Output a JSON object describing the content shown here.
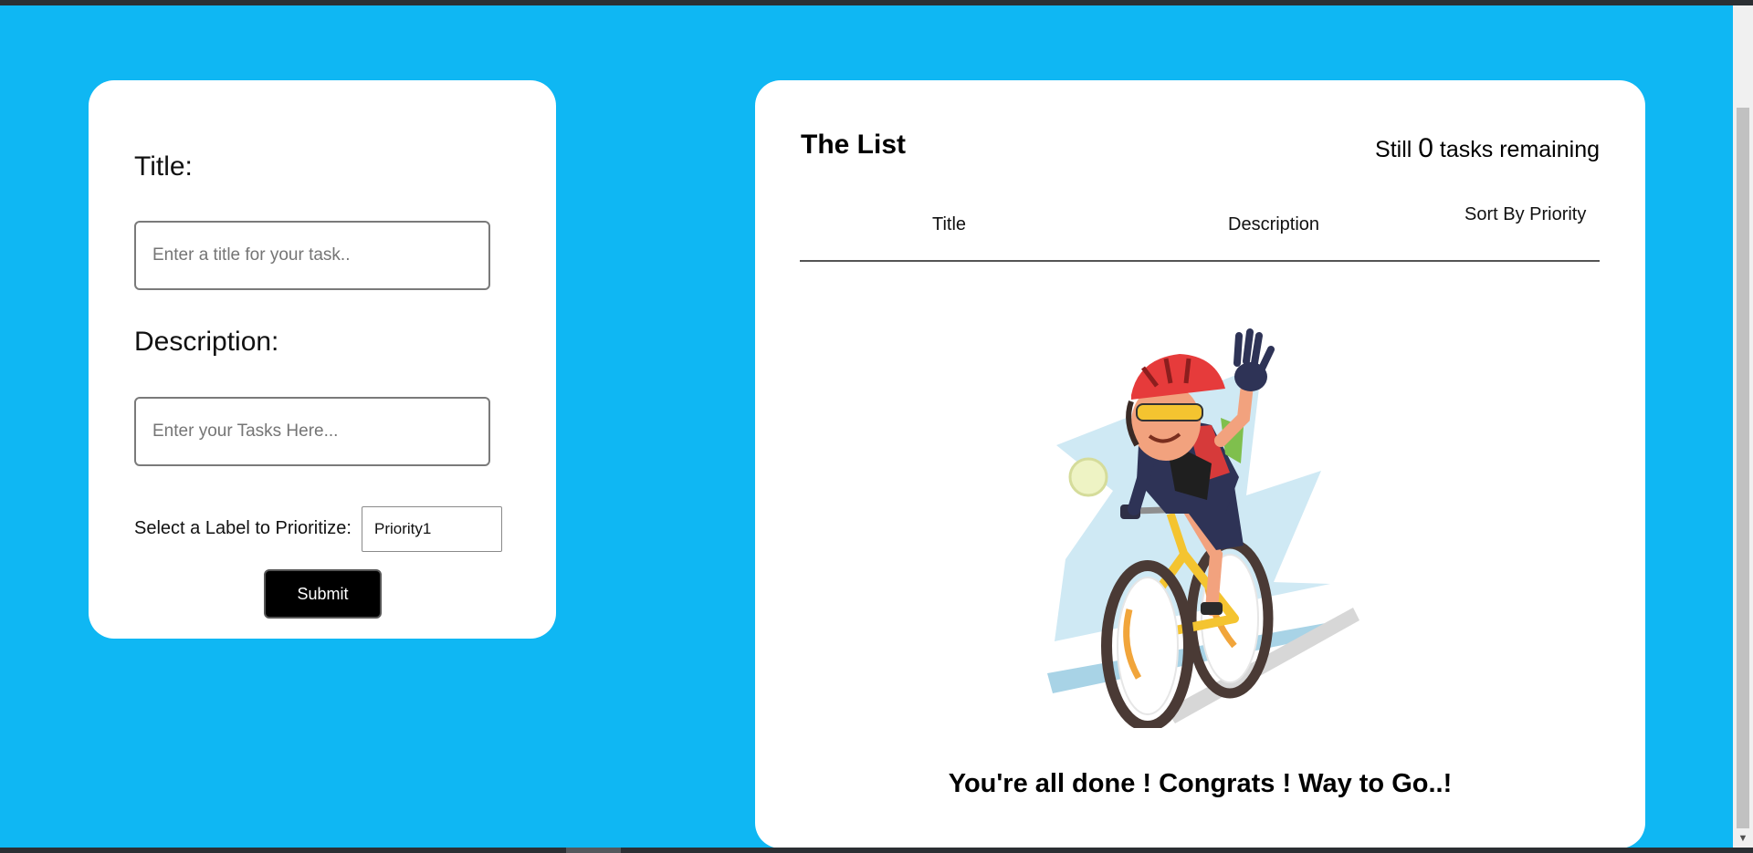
{
  "form": {
    "title_label": "Title:",
    "title_placeholder": "Enter a title for your task..",
    "title_value": "",
    "description_label": "Description:",
    "description_placeholder": "Enter your Tasks Here...",
    "description_value": "",
    "priority_label": "Select a Label to Prioritize:",
    "priority_selected": "Priority1",
    "submit_label": "Submit"
  },
  "list": {
    "heading": "The List",
    "remaining_prefix": "Still",
    "remaining_count": "0",
    "remaining_suffix": "tasks remaining",
    "columns": {
      "title": "Title",
      "description": "Description",
      "sort": "Sort By Priority"
    },
    "empty_message": "You're all done ! Congrats ! Way to Go..!"
  },
  "colors": {
    "background": "#0fb7f3",
    "card": "#ffffff",
    "button": "#000000"
  },
  "icons": {
    "scroll_down": "chevron-down-icon"
  }
}
